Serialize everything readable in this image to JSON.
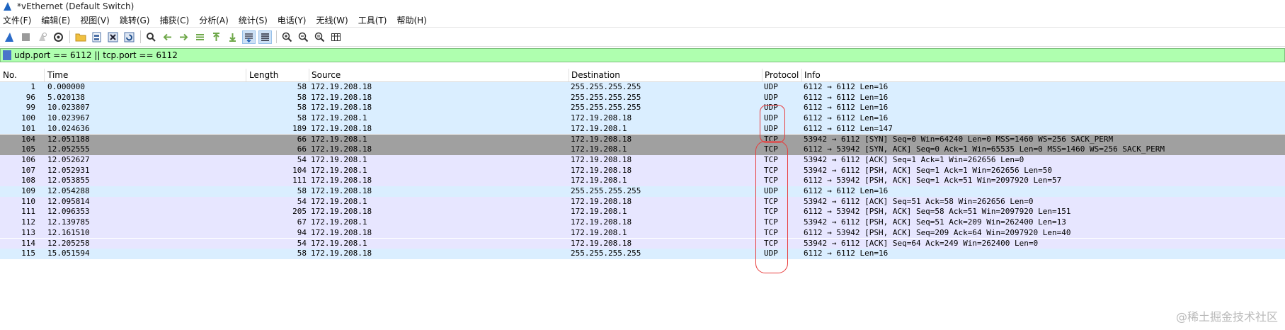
{
  "window": {
    "title": "*vEthernet (Default Switch)"
  },
  "menu": [
    "文件(F)",
    "编辑(E)",
    "视图(V)",
    "跳转(G)",
    "捕获(C)",
    "分析(A)",
    "统计(S)",
    "电话(Y)",
    "无线(W)",
    "工具(T)",
    "帮助(H)"
  ],
  "filter": {
    "value": "udp.port == 6112 || tcp.port == 6112"
  },
  "columns": [
    "No.",
    "Time",
    "Length",
    "Source",
    "Destination",
    "Protocol",
    "Info"
  ],
  "colors": {
    "udp": "#daeeff",
    "tcp": "#e7e6ff",
    "selected": "#a0a0a0",
    "filter_ok": "#afffaf",
    "annotation": "#e83c3c"
  },
  "rows": [
    {
      "no": "1",
      "time": "0.000000",
      "len": "58",
      "src": "172.19.208.18",
      "dst": "255.255.255.255",
      "proto": "UDP",
      "info": "6112 → 6112 Len=16",
      "bg": "udp"
    },
    {
      "no": "96",
      "time": "5.020138",
      "len": "58",
      "src": "172.19.208.18",
      "dst": "255.255.255.255",
      "proto": "UDP",
      "info": "6112 → 6112 Len=16",
      "bg": "udp"
    },
    {
      "no": "99",
      "time": "10.023807",
      "len": "58",
      "src": "172.19.208.18",
      "dst": "255.255.255.255",
      "proto": "UDP",
      "info": "6112 → 6112 Len=16",
      "bg": "udp"
    },
    {
      "no": "100",
      "time": "10.023967",
      "len": "58",
      "src": "172.19.208.1",
      "dst": "172.19.208.18",
      "proto": "UDP",
      "info": "6112 → 6112 Len=16",
      "bg": "udp"
    },
    {
      "no": "101",
      "time": "10.024636",
      "len": "189",
      "src": "172.19.208.18",
      "dst": "172.19.208.1",
      "proto": "UDP",
      "info": "6112 → 6112 Len=147",
      "bg": "udp"
    },
    {
      "no": "104",
      "time": "12.051188",
      "len": "66",
      "src": "172.19.208.1",
      "dst": "172.19.208.18",
      "proto": "TCP",
      "info": "53942 → 6112 [SYN] Seq=0 Win=64240 Len=0 MSS=1460 WS=256 SACK_PERM",
      "bg": "selected"
    },
    {
      "no": "105",
      "time": "12.052555",
      "len": "66",
      "src": "172.19.208.18",
      "dst": "172.19.208.1",
      "proto": "TCP",
      "info": "6112 → 53942 [SYN, ACK] Seq=0 Ack=1 Win=65535 Len=0 MSS=1460 WS=256 SACK_PERM",
      "bg": "selected"
    },
    {
      "no": "106",
      "time": "12.052627",
      "len": "54",
      "src": "172.19.208.1",
      "dst": "172.19.208.18",
      "proto": "TCP",
      "info": "53942 → 6112 [ACK] Seq=1 Ack=1 Win=262656 Len=0",
      "bg": "tcp"
    },
    {
      "no": "107",
      "time": "12.052931",
      "len": "104",
      "src": "172.19.208.1",
      "dst": "172.19.208.18",
      "proto": "TCP",
      "info": "53942 → 6112 [PSH, ACK] Seq=1 Ack=1 Win=262656 Len=50",
      "bg": "tcp"
    },
    {
      "no": "108",
      "time": "12.053855",
      "len": "111",
      "src": "172.19.208.18",
      "dst": "172.19.208.1",
      "proto": "TCP",
      "info": "6112 → 53942 [PSH, ACK] Seq=1 Ack=51 Win=2097920 Len=57",
      "bg": "tcp"
    },
    {
      "no": "109",
      "time": "12.054288",
      "len": "58",
      "src": "172.19.208.18",
      "dst": "255.255.255.255",
      "proto": "UDP",
      "info": "6112 → 6112 Len=16",
      "bg": "udp"
    },
    {
      "no": "110",
      "time": "12.095814",
      "len": "54",
      "src": "172.19.208.1",
      "dst": "172.19.208.18",
      "proto": "TCP",
      "info": "53942 → 6112 [ACK] Seq=51 Ack=58 Win=262656 Len=0",
      "bg": "tcp"
    },
    {
      "no": "111",
      "time": "12.096353",
      "len": "205",
      "src": "172.19.208.18",
      "dst": "172.19.208.1",
      "proto": "TCP",
      "info": "6112 → 53942 [PSH, ACK] Seq=58 Ack=51 Win=2097920 Len=151",
      "bg": "tcp"
    },
    {
      "no": "112",
      "time": "12.139785",
      "len": "67",
      "src": "172.19.208.1",
      "dst": "172.19.208.18",
      "proto": "TCP",
      "info": "53942 → 6112 [PSH, ACK] Seq=51 Ack=209 Win=262400 Len=13",
      "bg": "tcp"
    },
    {
      "no": "113",
      "time": "12.161510",
      "len": "94",
      "src": "172.19.208.18",
      "dst": "172.19.208.1",
      "proto": "TCP",
      "info": "6112 → 53942 [PSH, ACK] Seq=209 Ack=64 Win=2097920 Len=40",
      "bg": "tcp"
    },
    {
      "no": "114",
      "time": "12.205258",
      "len": "54",
      "src": "172.19.208.1",
      "dst": "172.19.208.18",
      "proto": "TCP",
      "info": "53942 → 6112 [ACK] Seq=64 Ack=249 Win=262400 Len=0",
      "bg": "tcp"
    },
    {
      "no": "115",
      "time": "15.051594",
      "len": "58",
      "src": "172.19.208.18",
      "dst": "255.255.255.255",
      "proto": "UDP",
      "info": "6112 → 6112 Len=16",
      "bg": "udp"
    }
  ],
  "watermark": "@稀土掘金技术社区"
}
